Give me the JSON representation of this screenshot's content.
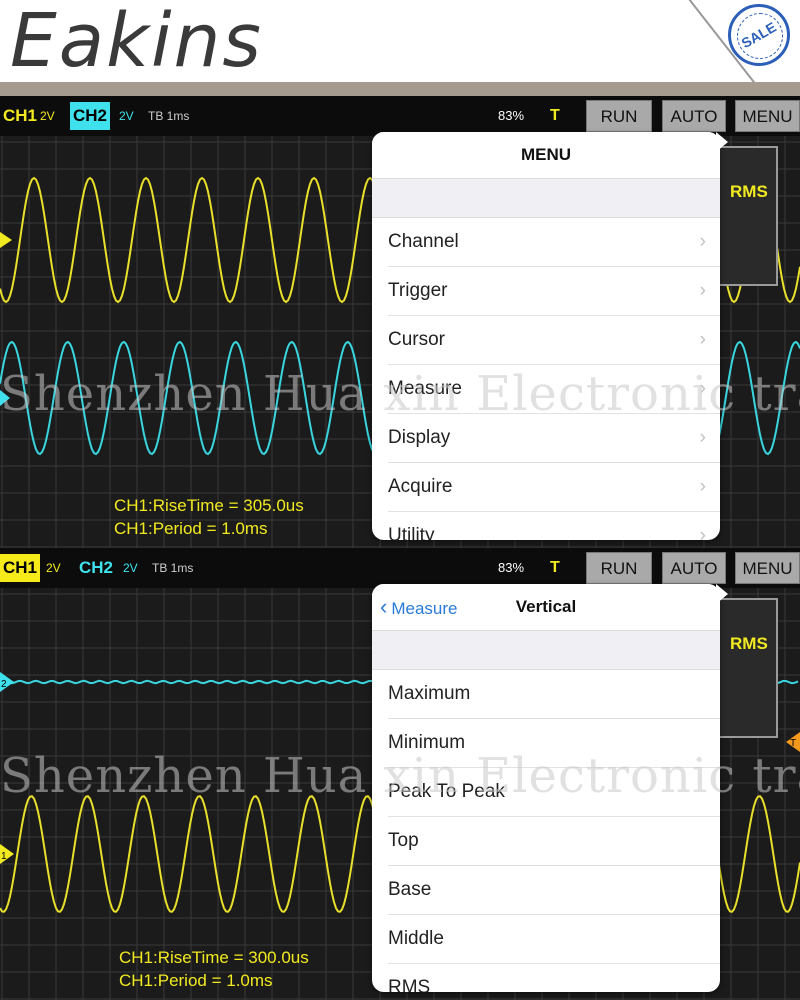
{
  "brand": "Eakins",
  "seal": "SALE",
  "watermark": "Shenzhen Hua xin Electronic trade co., LTD",
  "colors": {
    "ch1": "#f2ea20",
    "ch2": "#3fe2ec",
    "link": "#2a7ad8",
    "button": "#a9a9a9",
    "screen": "#1b1b1b"
  },
  "panels": [
    {
      "ch1": "CH1",
      "ch1_volts": "2V",
      "ch2": "CH2",
      "ch2_volts": "2V",
      "timebase": "TB 1ms",
      "percent": "83%",
      "trigger": "T",
      "buttons": {
        "run": "RUN",
        "auto": "AUTO",
        "menu": "MENU"
      },
      "side_label": "RMS",
      "measurements": [
        "CH1:RiseTime = 305.0us",
        "CH1:Period = 1.0ms"
      ],
      "popover": {
        "title": "MENU",
        "items": [
          "Channel",
          "Trigger",
          "Cursor",
          "Measure",
          "Display",
          "Acquire",
          "Utility"
        ]
      }
    },
    {
      "ch1": "CH1",
      "ch1_volts": "2V",
      "ch2": "CH2",
      "ch2_volts": "2V",
      "timebase": "TB 1ms",
      "percent": "83%",
      "trigger": "T",
      "buttons": {
        "run": "RUN",
        "auto": "AUTO",
        "menu": "MENU"
      },
      "side_label": "RMS",
      "marker_ch1": "1",
      "marker_ch2": "2",
      "marker_trigger": "T",
      "measurements": [
        "CH1:RiseTime = 300.0us",
        "CH1:Period = 1.0ms"
      ],
      "popover": {
        "back": "Measure",
        "title": "Vertical",
        "items": [
          "Maximum",
          "Minimum",
          "Peak To Peak",
          "Top",
          "Base",
          "Middle",
          "RMS"
        ]
      }
    }
  ]
}
